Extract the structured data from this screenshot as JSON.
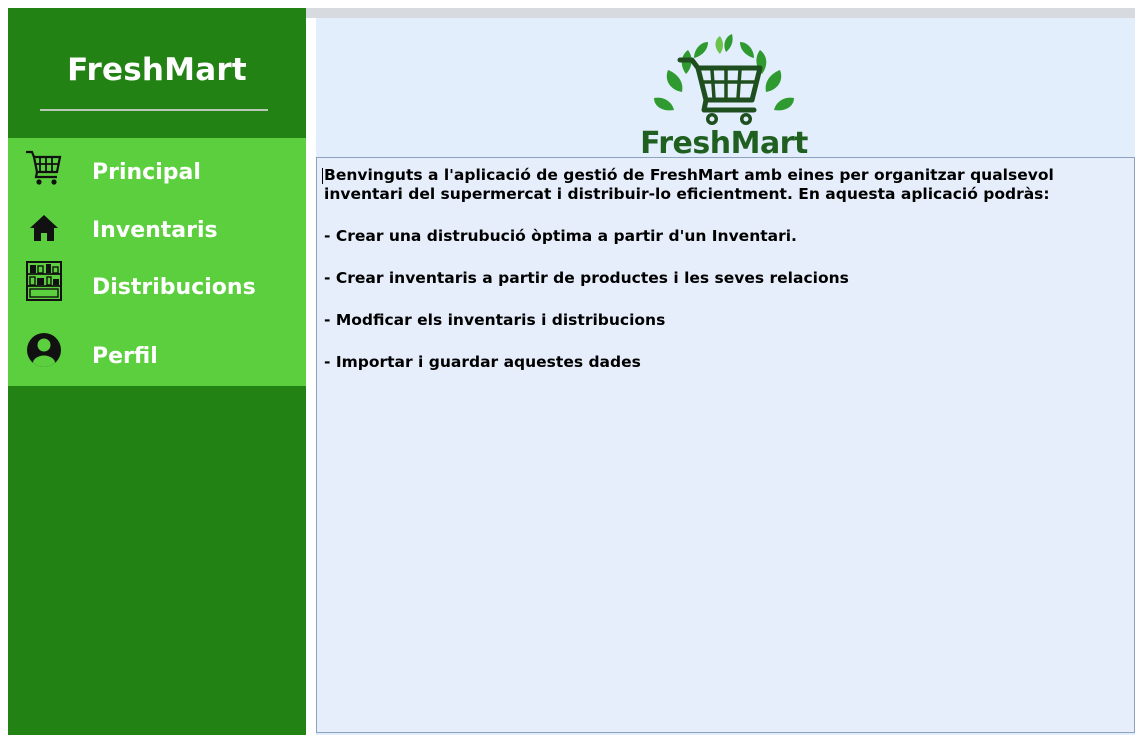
{
  "sidebar": {
    "brand": "FreshMart",
    "nav": [
      {
        "label": "Principal",
        "icon": "shopping-cart-icon"
      },
      {
        "label": "Inventaris",
        "icon": "home-icon"
      },
      {
        "label": "Distribucions",
        "icon": "shelf-icon"
      },
      {
        "label": "Perfil",
        "icon": "user-icon"
      }
    ]
  },
  "main": {
    "logo_text": "FreshMart",
    "intro": "Benvinguts a l'aplicació de gestió de FreshMart amb eines per organitzar qualsevol inventari del supermercat i distribuir-lo eficientment. En aquesta aplicació podràs:",
    "bullets": [
      "- Crear una distrubució òptima a partir d'un Inventari.",
      "- Crear inventaris a partir de productes i les seves relacions",
      "- Modficar els inventaris i distribucions",
      "- Importar i guardar aquestes dades"
    ]
  },
  "colors": {
    "sidebar": "#228213",
    "nav": "#5ccf3e",
    "content_bg": "#e3eefc",
    "logo_green": "#2e8b2e"
  }
}
